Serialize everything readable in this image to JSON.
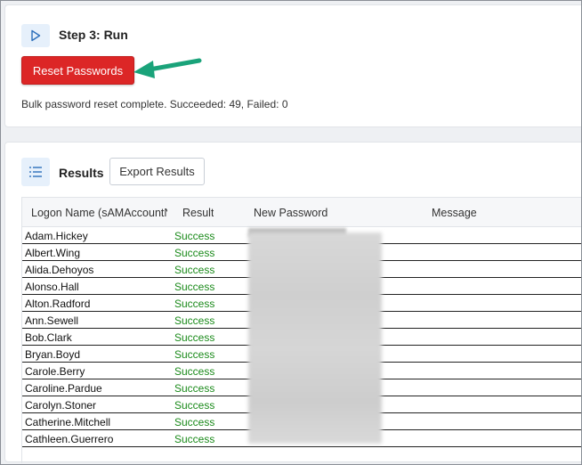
{
  "step": {
    "title": "Step 3: Run",
    "reset_label": "Reset Passwords",
    "status": "Bulk password reset complete. Succeeded: 49, Failed: 0"
  },
  "results": {
    "title": "Results",
    "export_label": "Export Results",
    "columns": {
      "logon": "Logon Name (sAMAccountName)",
      "result": "Result",
      "password": "New Password",
      "message": "Message"
    },
    "rows": [
      {
        "logon": "Adam.Hickey",
        "result": "Success"
      },
      {
        "logon": "Albert.Wing",
        "result": "Success"
      },
      {
        "logon": "Alida.Dehoyos",
        "result": "Success"
      },
      {
        "logon": "Alonso.Hall",
        "result": "Success"
      },
      {
        "logon": "Alton.Radford",
        "result": "Success"
      },
      {
        "logon": "Ann.Sewell",
        "result": "Success"
      },
      {
        "logon": "Bob.Clark",
        "result": "Success"
      },
      {
        "logon": "Bryan.Boyd",
        "result": "Success"
      },
      {
        "logon": "Carole.Berry",
        "result": "Success"
      },
      {
        "logon": "Caroline.Pardue",
        "result": "Success"
      },
      {
        "logon": "Carolyn.Stoner",
        "result": "Success"
      },
      {
        "logon": "Catherine.Mitchell",
        "result": "Success"
      },
      {
        "logon": "Cathleen.Guerrero",
        "result": "Success"
      }
    ]
  },
  "icons": {
    "step": "play-icon",
    "results": "list-icon",
    "annotation": "arrow-icon"
  },
  "colors": {
    "reset_button": "#dc2626",
    "arrow": "#1aa37a",
    "success": "#1a8a1a",
    "icon_bg": "#e6f0fb"
  }
}
